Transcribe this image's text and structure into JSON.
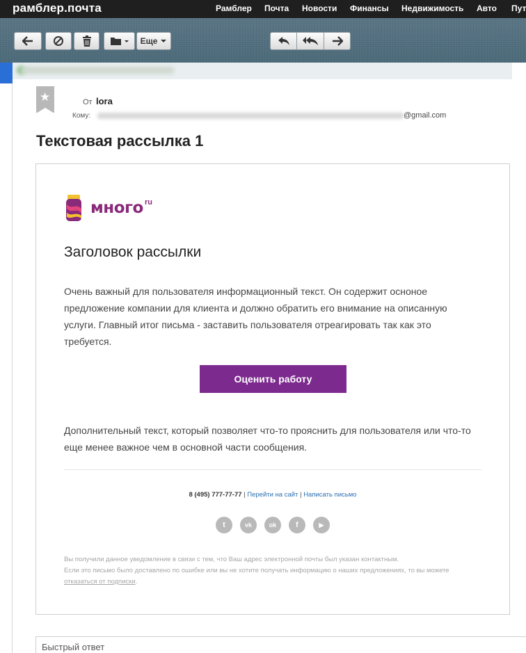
{
  "app": {
    "logo": "рамблер.почта"
  },
  "topnav": {
    "items": [
      "Рамблер",
      "Почта",
      "Новости",
      "Финансы",
      "Недвижимость",
      "Авто",
      "Пут"
    ]
  },
  "toolbar": {
    "more_label": "Еще",
    "icons": [
      "back-arrow-icon",
      "spam-icon",
      "trash-icon",
      "folder-icon",
      "reply-icon",
      "reply-all-icon",
      "forward-icon"
    ]
  },
  "message": {
    "from_label": "От",
    "from_value": "lora",
    "to_label": "Кому:",
    "to_suffix": "@gmail.com",
    "subject": "Текстовая рассылка 1"
  },
  "email": {
    "brand_name": "много",
    "brand_tld": "ru",
    "title": "Заголовок рассылки",
    "body": "Очень важный для пользователя информационный текст. Он содержит осноное предложение компании для клиента и должно обратить его внимание на описанную услуги. Главный итог письма - заставить пользователя отреагировать так как это требуется.",
    "cta_label": "Оценить работу",
    "extra": "Дополнительный текст, который позволяет что-то прояснить для пользователя или что-то еще менее важное чем в основной части сообщения.",
    "phone": "8 (495) 777-77-77",
    "sep": "|",
    "site_link": "Перейти на сайт",
    "write_link": "Написать письмо",
    "socials": {
      "twitter": "t",
      "vk": "vk",
      "ok": "ok",
      "facebook": "f",
      "youtube": "▶"
    },
    "footnote_1": "Вы получили данное уведомление в связи с тем, что Ваш адрес электронной почты был указан контактным.",
    "footnote_2": "Если это письмо было доставлено по ошибке или вы не хотите получать информацию о наших предложениях, то вы можете",
    "unsubscribe": "отказаться от подписки",
    "footnote_end": "."
  },
  "quick_reply": {
    "placeholder": "Быстрый ответ"
  },
  "colors": {
    "cta": "#7c2a8e",
    "brand": "#8a2a7a",
    "toolbar": "#4f6d7c"
  }
}
